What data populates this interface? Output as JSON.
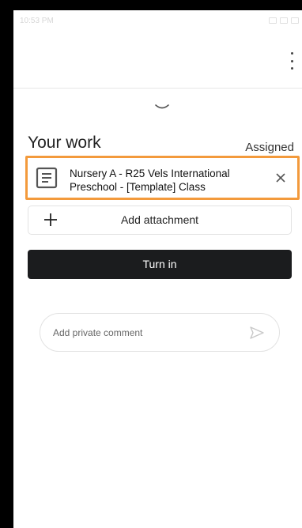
{
  "status_bar": {
    "time": "10:53 PM"
  },
  "work": {
    "heading": "Your work",
    "status": "Assigned",
    "attachment": {
      "title": "Nursery A - R25 Vels International Preschool - [Template] Class",
      "icon": "document-icon"
    },
    "add_attachment_label": "Add attachment",
    "turn_in_label": "Turn in"
  },
  "comment": {
    "placeholder": "Add private comment"
  },
  "colors": {
    "highlight": "#f39a3c",
    "button_bg": "#1b1c1e"
  }
}
